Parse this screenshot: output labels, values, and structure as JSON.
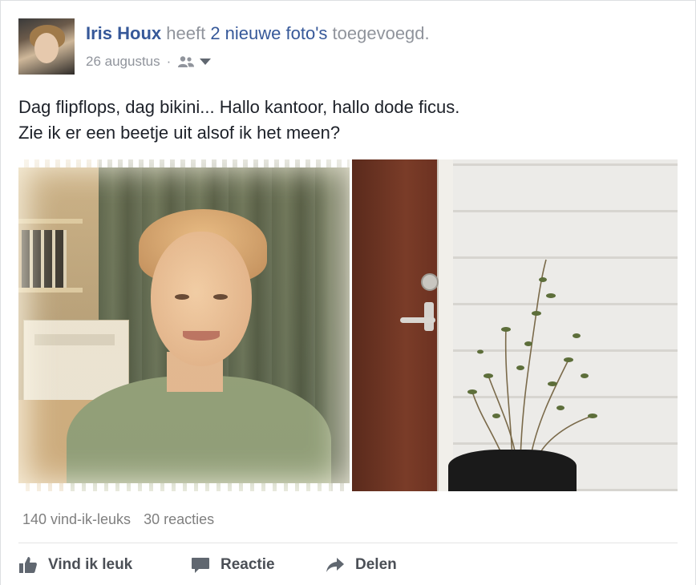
{
  "post": {
    "author_name": "Iris Houx",
    "action_prefix": "heeft",
    "action_link": "2 nieuwe foto's",
    "action_suffix": "toegevoegd.",
    "date": "26 augustus",
    "separator": "·",
    "audience_icon": "friends-icon",
    "message_lines": [
      "Dag flipflops, dag bikini... Hallo kantoor, hallo dode ficus.",
      "Zie ik er een beetje uit alsof ik het meen?"
    ]
  },
  "photos": [
    {
      "subject": "woman-portrait"
    },
    {
      "subject": "ficus-plant"
    }
  ],
  "stats": {
    "likes": "140 vind-ik-leuks",
    "comments": "30 reacties"
  },
  "actions": {
    "like_label": "Vind ik leuk",
    "comment_label": "Reactie",
    "share_label": "Delen"
  },
  "colors": {
    "link": "#365899",
    "secondary_text": "#90949c",
    "action_text": "#4b4f56",
    "icon": "#606770"
  }
}
